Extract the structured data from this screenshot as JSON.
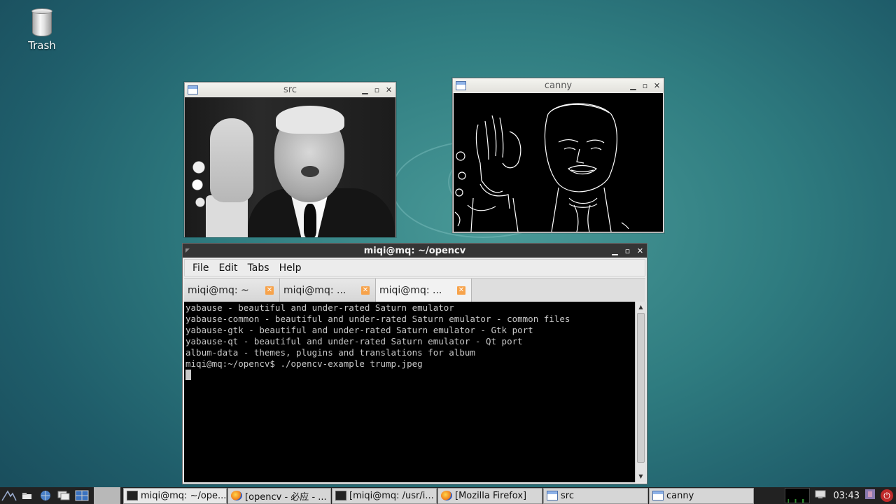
{
  "desktop": {
    "icons": [
      {
        "label": "Trash",
        "icon": "trash-icon"
      }
    ]
  },
  "windows": {
    "src": {
      "title": "src",
      "ctrl_min": "▁",
      "ctrl_max": "▫",
      "ctrl_close": "✕"
    },
    "canny": {
      "title": "canny",
      "ctrl_min": "▁",
      "ctrl_max": "▫",
      "ctrl_close": "✕"
    },
    "terminal": {
      "title": "miqi@mq: ~/opencv",
      "ctrl_min": "▁",
      "ctrl_max": "▫",
      "ctrl_close": "✕",
      "menu": [
        "File",
        "Edit",
        "Tabs",
        "Help"
      ],
      "tabs": [
        {
          "label": "miqi@mq: ~",
          "active": false
        },
        {
          "label": "miqi@mq: ...",
          "active": false
        },
        {
          "label": "miqi@mq: ...",
          "active": true
        }
      ],
      "tab_close": "✕",
      "lines": [
        "yabause - beautiful and under-rated Saturn emulator",
        "yabause-common - beautiful and under-rated Saturn emulator - common files",
        "yabause-gtk - beautiful and under-rated Saturn emulator - Gtk port",
        "yabause-qt - beautiful and under-rated Saturn emulator - Qt port",
        "album-data - themes, plugins and translations for album",
        "miqi@mq:~/opencv$ ./opencv-example trump.jpeg"
      ],
      "scroll_up": "▲",
      "scroll_down": "▼"
    }
  },
  "taskbar": {
    "launchers": [
      "start-menu-icon",
      "file-manager-icon",
      "browser-icon",
      "show-desktop-icon",
      "workspace-icon"
    ],
    "tasks": [
      {
        "label": "miqi@mq: ~/ope...",
        "icon": "terminal-icon",
        "active": true
      },
      {
        "label": "[opencv - 必应 - ...",
        "icon": "firefox-icon",
        "active": false
      },
      {
        "label": "[miqi@mq: /usr/i...",
        "icon": "terminal-icon",
        "active": false
      },
      {
        "label": "[Mozilla Firefox]",
        "icon": "firefox-icon",
        "active": false
      },
      {
        "label": "src",
        "icon": "window-icon",
        "active": false
      },
      {
        "label": "canny",
        "icon": "window-icon",
        "active": false
      }
    ],
    "clock": "03:43",
    "power_glyph": "⏻"
  },
  "colors": {
    "desktop_bg": "#2f7c80",
    "terminal_titlebar": "#353535",
    "tab_close": "#f7a34b",
    "power": "#c02a2a"
  }
}
